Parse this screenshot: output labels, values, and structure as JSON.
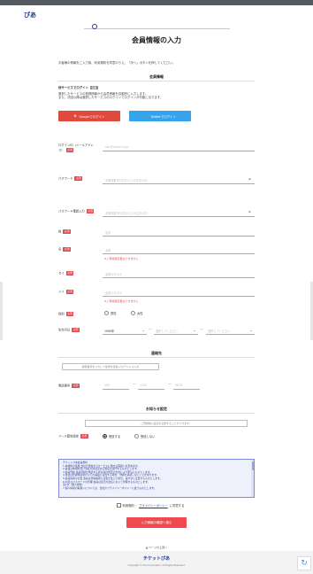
{
  "header": {
    "logo": "ぴあ",
    "title": "会員情報の入力"
  },
  "lead": "お客様の情報をご入力後、利用規約を同意のうえ、「次へ」ボタンを押してください。",
  "sections": {
    "member": "会員情報",
    "contact": "連絡先",
    "newsletter": "お知らせ設定"
  },
  "sns": {
    "title": "他サービスでログイン",
    "badge": "任意",
    "desc_1": "選択したサービスの登録情報から会員情報を自動的に入力します。",
    "desc_2": "また、次回以降は選択したサービスのログインでログインが可能になります。",
    "google_label": "Googleでログイン",
    "twitter_label": "Twitterでログイン",
    "google_icon": "G",
    "twitter_icon": "🐦"
  },
  "badges": {
    "required": "必須",
    "optional": "任意"
  },
  "fields": {
    "email": {
      "label": "ログインID（メールアドレス）",
      "placeholder": "abc@email.co.jp"
    },
    "password": {
      "label": "パスワード",
      "placeholder": "半角英数字6文字以上20文字以内"
    },
    "password_confirm": {
      "label": "パスワード確認入力",
      "placeholder": "半角英数字6文字以上20文字以内"
    },
    "last_name": {
      "label": "姓",
      "placeholder": "会員"
    },
    "first_name": {
      "label": "名",
      "placeholder": "太郎",
      "error": "※ご登録後変更はできません"
    },
    "last_kana": {
      "label": "セイ",
      "placeholder": "全角カタカナ"
    },
    "first_kana": {
      "label": "メイ",
      "placeholder": "全角カタカナ",
      "error": "※ご登録後変更はできません"
    },
    "gender": {
      "label": "性別",
      "options": [
        "男性",
        "女性"
      ]
    },
    "birthday": {
      "label": "生年月日",
      "year": "1990年",
      "month": "選択してください",
      "day": "選択してください",
      "tilde": "〜"
    },
    "zip_button": "郵便番号を入力して住所を自動入力/アドレス入力",
    "phone": {
      "label": "電話番号",
      "p1": "090",
      "p2": "1234",
      "p3": "5678",
      "sep": "ー"
    }
  },
  "newsletter": {
    "button": "ご登録後に設定を変更することができます。",
    "label": "メール配信設定",
    "options": [
      "受信する",
      "受信しない"
    ]
  },
  "terms": [
    "チケットぴあ会員規約",
    "1.本規約の適用 当社が運営するサービスに関する取扱いを定めます。",
    "2.会員は本規約及び当社が別途定める規定を遵守するものとします。",
    "3.会員登録 会員登録を希望する者は当社所定の方法により申込むものとします。",
    "4.当社は登録申請者が以下の事由に該当する場合、登録を承認しないことがあります。",
    "5.会員情報の変更 会員は登録事項に変更が生じた場合、速やかに変更するものとします。",
    "6.ID及びパスワードの管理 会員は自己の責任において管理するものとします。",
    "第1条（個人情報）",
    "7.個人情報の取扱いについては、当社のプライバシーポリシーに従うものとします。"
  ],
  "agree": {
    "prefix": "利用規約・",
    "link": "プライバシーポリシー",
    "suffix": "に同意する"
  },
  "submit": "入力情報の確認へ進む",
  "pagetop": "▲ ページの上部へ",
  "footer": {
    "logo": "チケットぴあ",
    "copyright": "Copyright © PIA Corporation. All Rights Reserved."
  },
  "colors": {
    "brand": "#1f3d8c",
    "required": "#e5484d",
    "google": "#e04a3d",
    "twitter": "#36a3ea",
    "submit": "#ef4b4f"
  }
}
